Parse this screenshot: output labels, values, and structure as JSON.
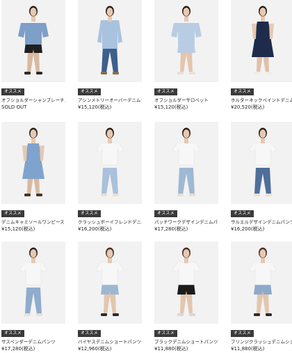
{
  "products": [
    {
      "badge": "オススメ",
      "name": "オフショルダーシャンブレーチュニック",
      "price": "SOLD OUT",
      "model": {
        "top": "#7d9fc8",
        "top_style": "offshoulder-tunic",
        "bottom": "#1f1f1f",
        "bottom_style": "shorts",
        "legs": "#d9b9a0",
        "shoes": "#2b2b2b",
        "hair": "#2a1d16"
      }
    },
    {
      "badge": "オススメ",
      "name": "アシンメトリーオーバーデニムシャツ",
      "price": "¥15,120(税込)",
      "model": {
        "top": "#a9c3df",
        "top_style": "shirt",
        "bottom": "#3d5f8c",
        "bottom_style": "jeans",
        "legs": "#3d5f8c",
        "shoes": "#8a6d55",
        "hair": "#2a1d16"
      }
    },
    {
      "badge": "オススメ",
      "name": "オフショルダーサロペット",
      "price": "¥15,120(税込)",
      "model": {
        "top": "#b8cde3",
        "top_style": "offshoulder-romper",
        "bottom": "#b8cde3",
        "bottom_style": "shorts",
        "legs": "#e3c6ae",
        "shoes": "#e9e0d6",
        "hair": "#2a1d16"
      }
    },
    {
      "badge": "オススメ",
      "name": "ホルターネックペイントデニムワンピース",
      "price": "¥20,520(税込)",
      "model": {
        "top": "#1e2b4a",
        "top_style": "halter-dress",
        "bottom": "#1e2b4a",
        "bottom_style": "dress",
        "legs": "#e0c0a8",
        "shoes": "#f0ede8",
        "hair": "#2a1d16"
      }
    },
    {
      "badge": "オススメ",
      "name": "デニムキャミソールワンピース",
      "price": "¥15,120(税込)",
      "model": {
        "top": "#7fa3cd",
        "top_style": "cami-dress",
        "bottom": "#7fa3cd",
        "bottom_style": "dress",
        "legs": "#d9b9a0",
        "shoes": "#4a3527",
        "hair": "#2a1d16"
      }
    },
    {
      "badge": "オススメ",
      "name": "クラッシュボーイフレンドデニムパンツ",
      "price": "¥16,200(税込)",
      "model": {
        "top": "#f7f7f7",
        "top_style": "tee",
        "bottom": "#a9c1da",
        "bottom_style": "jeans",
        "legs": "#a9c1da",
        "shoes": "#e9e0d6",
        "hair": "#2a1d16"
      }
    },
    {
      "badge": "オススメ",
      "name": "パッチワークデザインデニムパンツ",
      "price": "¥17,280(税込)",
      "model": {
        "top": "#f7f7f7",
        "top_style": "tee",
        "bottom": "#9fb8d3",
        "bottom_style": "jeans",
        "legs": "#9fb8d3",
        "shoes": "#e9e0d6",
        "hair": "#2a1d16"
      }
    },
    {
      "badge": "オススメ",
      "name": "サルエルデザインデニムパンツ",
      "price": "¥16,200(税込)",
      "model": {
        "top": "#f7f7f7",
        "top_style": "tee",
        "bottom": "#4f6f9a",
        "bottom_style": "jeans",
        "legs": "#4f6f9a",
        "shoes": "#e9e0d6",
        "hair": "#2a1d16"
      }
    },
    {
      "badge": "オススメ",
      "name": "サスペンダーデニムパンツ",
      "price": "¥17,280(税込)",
      "model": {
        "top": "#f7f7f7",
        "top_style": "tee",
        "bottom": "#8faccd",
        "bottom_style": "jeans",
        "legs": "#8faccd",
        "shoes": "#e9e0d6",
        "hair": "#2a1d16"
      }
    },
    {
      "badge": "オススメ",
      "name": "バイヤスデニムショートパンツ",
      "price": "¥12,960(税込)",
      "model": {
        "top": "#f7f7f7",
        "top_style": "tee",
        "bottom": "#9db7d2",
        "bottom_style": "shorts",
        "legs": "#e3c6ae",
        "shoes": "#2b2b2b",
        "hair": "#4a2e20"
      }
    },
    {
      "badge": "オススメ",
      "name": "ブラックデニムショートパンツ",
      "price": "¥11,880(税込)",
      "model": {
        "top": "#f7f7f7",
        "top_style": "tee",
        "bottom": "#1c1c1c",
        "bottom_style": "shorts",
        "legs": "#e3c6ae",
        "shoes": "#d8d8d8",
        "hair": "#4a2e20"
      }
    },
    {
      "badge": "オススメ",
      "name": "フリンジクラッシュデニムショートパンツ",
      "price": "¥11,880(税込)",
      "model": {
        "top": "#f7f7f7",
        "top_style": "tee",
        "bottom": "#8eaacb",
        "bottom_style": "shorts",
        "legs": "#e3c6ae",
        "shoes": "#2b2b2b",
        "hair": "#4a2e20"
      }
    }
  ]
}
